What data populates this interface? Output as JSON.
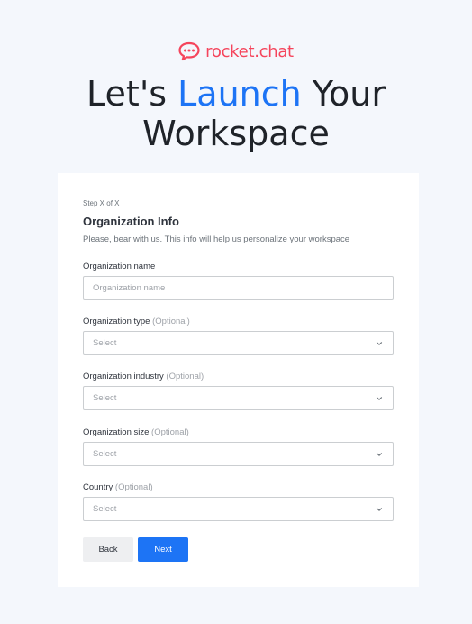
{
  "brand": {
    "name": "rocket.chat",
    "color": "#f5455c",
    "icon": "rocket-chat-logo-icon"
  },
  "headline": {
    "part1": "Let's ",
    "accent": "Launch",
    "part2": " Your",
    "line2": "Workspace",
    "accent_color": "#1d74f5"
  },
  "form": {
    "step": "Step X of X",
    "title": "Organization Info",
    "subtitle": "Please, bear with us. This info will help us personalize your workspace",
    "org_name": {
      "label": "Organization name",
      "placeholder": "Organization name",
      "value": ""
    },
    "org_type": {
      "label": "Organization type",
      "optional": "(Optional)",
      "value": "Select"
    },
    "org_industry": {
      "label": "Organization industry",
      "optional": "(Optional)",
      "value": "Select"
    },
    "org_size": {
      "label": "Organization size",
      "optional": "(Optional)",
      "value": "Select"
    },
    "country": {
      "label": "Country",
      "optional": "(Optional)",
      "value": "Select"
    },
    "back_label": "Back",
    "next_label": "Next"
  }
}
